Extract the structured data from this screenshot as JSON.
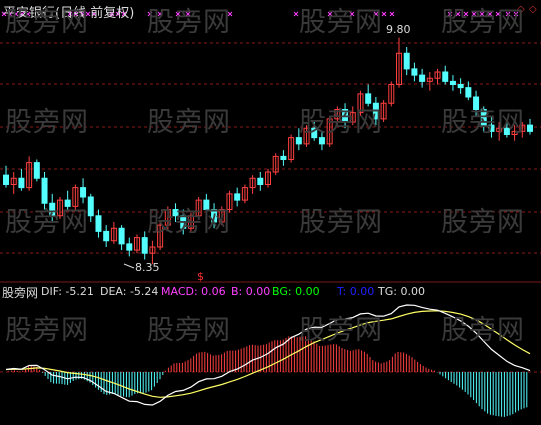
{
  "stock_title": "平安银行(日线 前复权)",
  "watermark": "股旁网",
  "corner_icons": [
    "◇",
    "◇"
  ],
  "price_panel": {
    "high_label": "9.80",
    "low_label": "8.35",
    "signal_marker": "$"
  },
  "indicator": {
    "name_label": "股旁网",
    "dif": "DIF: -5.21",
    "dea": "DEA: -5.24",
    "macd": "MACD: 0.06",
    "b": "B: 0.00",
    "bg": "BG: 0.00",
    "t": "T: 0.00",
    "tg": "TG: 0.00"
  },
  "colors": {
    "background": "#000000",
    "up_candle": "#ff4040",
    "down_candle": "#54ffff",
    "grid": "#8b1a1a",
    "dif_line": "#ffffff",
    "dea_line": "#ffff66",
    "cross_marker": "#ff40ff",
    "macd_label": "#ff40ff",
    "bg_label": "#00ff00",
    "t_label": "#2020ff"
  },
  "chart_data": {
    "type": "candlestick",
    "title": "平安银行(日线 前复权)",
    "high_point": 9.8,
    "low_point": 8.35,
    "candles": [
      {
        "o": 8.92,
        "h": 8.98,
        "l": 8.84,
        "c": 8.86
      },
      {
        "o": 8.86,
        "h": 8.94,
        "l": 8.8,
        "c": 8.9
      },
      {
        "o": 8.9,
        "h": 8.96,
        "l": 8.82,
        "c": 8.84
      },
      {
        "o": 8.84,
        "h": 9.04,
        "l": 8.82,
        "c": 9.0
      },
      {
        "o": 9.0,
        "h": 9.02,
        "l": 8.88,
        "c": 8.9
      },
      {
        "o": 8.9,
        "h": 8.94,
        "l": 8.7,
        "c": 8.74
      },
      {
        "o": 8.74,
        "h": 8.8,
        "l": 8.62,
        "c": 8.66
      },
      {
        "o": 8.66,
        "h": 8.78,
        "l": 8.64,
        "c": 8.76
      },
      {
        "o": 8.76,
        "h": 8.82,
        "l": 8.7,
        "c": 8.72
      },
      {
        "o": 8.72,
        "h": 8.86,
        "l": 8.7,
        "c": 8.84
      },
      {
        "o": 8.84,
        "h": 8.9,
        "l": 8.74,
        "c": 8.78
      },
      {
        "o": 8.78,
        "h": 8.8,
        "l": 8.62,
        "c": 8.66
      },
      {
        "o": 8.66,
        "h": 8.7,
        "l": 8.52,
        "c": 8.56
      },
      {
        "o": 8.56,
        "h": 8.6,
        "l": 8.46,
        "c": 8.5
      },
      {
        "o": 8.5,
        "h": 8.62,
        "l": 8.48,
        "c": 8.58
      },
      {
        "o": 8.58,
        "h": 8.6,
        "l": 8.44,
        "c": 8.48
      },
      {
        "o": 8.48,
        "h": 8.52,
        "l": 8.4,
        "c": 8.44
      },
      {
        "o": 8.44,
        "h": 8.54,
        "l": 8.42,
        "c": 8.52
      },
      {
        "o": 8.52,
        "h": 8.56,
        "l": 8.38,
        "c": 8.42
      },
      {
        "o": 8.42,
        "h": 8.5,
        "l": 8.35,
        "c": 8.46
      },
      {
        "o": 8.46,
        "h": 8.62,
        "l": 8.44,
        "c": 8.6
      },
      {
        "o": 8.6,
        "h": 8.72,
        "l": 8.56,
        "c": 8.7
      },
      {
        "o": 8.7,
        "h": 8.74,
        "l": 8.62,
        "c": 8.66
      },
      {
        "o": 8.66,
        "h": 8.7,
        "l": 8.54,
        "c": 8.58
      },
      {
        "o": 8.58,
        "h": 8.68,
        "l": 8.56,
        "c": 8.66
      },
      {
        "o": 8.66,
        "h": 8.78,
        "l": 8.64,
        "c": 8.76
      },
      {
        "o": 8.76,
        "h": 8.8,
        "l": 8.66,
        "c": 8.7
      },
      {
        "o": 8.7,
        "h": 8.74,
        "l": 8.58,
        "c": 8.62
      },
      {
        "o": 8.62,
        "h": 8.72,
        "l": 8.6,
        "c": 8.7
      },
      {
        "o": 8.7,
        "h": 8.82,
        "l": 8.68,
        "c": 8.8
      },
      {
        "o": 8.8,
        "h": 8.84,
        "l": 8.72,
        "c": 8.76
      },
      {
        "o": 8.76,
        "h": 8.86,
        "l": 8.74,
        "c": 8.84
      },
      {
        "o": 8.84,
        "h": 8.92,
        "l": 8.8,
        "c": 8.9
      },
      {
        "o": 8.9,
        "h": 8.94,
        "l": 8.82,
        "c": 8.86
      },
      {
        "o": 8.86,
        "h": 8.96,
        "l": 8.84,
        "c": 8.94
      },
      {
        "o": 8.94,
        "h": 9.06,
        "l": 8.92,
        "c": 9.04
      },
      {
        "o": 9.04,
        "h": 9.08,
        "l": 8.98,
        "c": 9.02
      },
      {
        "o": 9.02,
        "h": 9.18,
        "l": 9.0,
        "c": 9.16
      },
      {
        "o": 9.16,
        "h": 9.22,
        "l": 9.08,
        "c": 9.12
      },
      {
        "o": 9.12,
        "h": 9.24,
        "l": 9.1,
        "c": 9.22
      },
      {
        "o": 9.22,
        "h": 9.26,
        "l": 9.14,
        "c": 9.16
      },
      {
        "o": 9.16,
        "h": 9.2,
        "l": 9.08,
        "c": 9.12
      },
      {
        "o": 9.12,
        "h": 9.3,
        "l": 9.1,
        "c": 9.28
      },
      {
        "o": 9.28,
        "h": 9.36,
        "l": 9.24,
        "c": 9.34
      },
      {
        "o": 9.34,
        "h": 9.38,
        "l": 9.22,
        "c": 9.26
      },
      {
        "o": 9.26,
        "h": 9.36,
        "l": 9.24,
        "c": 9.32
      },
      {
        "o": 9.32,
        "h": 9.46,
        "l": 9.3,
        "c": 9.44
      },
      {
        "o": 9.44,
        "h": 9.5,
        "l": 9.36,
        "c": 9.38
      },
      {
        "o": 9.38,
        "h": 9.42,
        "l": 9.24,
        "c": 9.28
      },
      {
        "o": 9.28,
        "h": 9.4,
        "l": 9.26,
        "c": 9.38
      },
      {
        "o": 9.38,
        "h": 9.52,
        "l": 9.36,
        "c": 9.5
      },
      {
        "o": 9.5,
        "h": 9.8,
        "l": 9.48,
        "c": 9.7
      },
      {
        "o": 9.7,
        "h": 9.74,
        "l": 9.56,
        "c": 9.6
      },
      {
        "o": 9.6,
        "h": 9.64,
        "l": 9.52,
        "c": 9.56
      },
      {
        "o": 9.56,
        "h": 9.6,
        "l": 9.48,
        "c": 9.52
      },
      {
        "o": 9.52,
        "h": 9.58,
        "l": 9.46,
        "c": 9.54
      },
      {
        "o": 9.54,
        "h": 9.6,
        "l": 9.5,
        "c": 9.58
      },
      {
        "o": 9.58,
        "h": 9.62,
        "l": 9.5,
        "c": 9.52
      },
      {
        "o": 9.52,
        "h": 9.56,
        "l": 9.46,
        "c": 9.5
      },
      {
        "o": 9.5,
        "h": 9.54,
        "l": 9.44,
        "c": 9.48
      },
      {
        "o": 9.48,
        "h": 9.52,
        "l": 9.4,
        "c": 9.42
      },
      {
        "o": 9.42,
        "h": 9.46,
        "l": 9.3,
        "c": 9.34
      },
      {
        "o": 9.34,
        "h": 9.36,
        "l": 9.2,
        "c": 9.24
      },
      {
        "o": 9.24,
        "h": 9.3,
        "l": 9.16,
        "c": 9.2
      },
      {
        "o": 9.2,
        "h": 9.26,
        "l": 9.14,
        "c": 9.22
      },
      {
        "o": 9.22,
        "h": 9.28,
        "l": 9.16,
        "c": 9.18
      },
      {
        "o": 9.18,
        "h": 9.24,
        "l": 9.14,
        "c": 9.2
      },
      {
        "o": 9.2,
        "h": 9.26,
        "l": 9.16,
        "c": 9.24
      },
      {
        "o": 9.24,
        "h": 9.28,
        "l": 9.18,
        "c": 9.2
      }
    ]
  }
}
